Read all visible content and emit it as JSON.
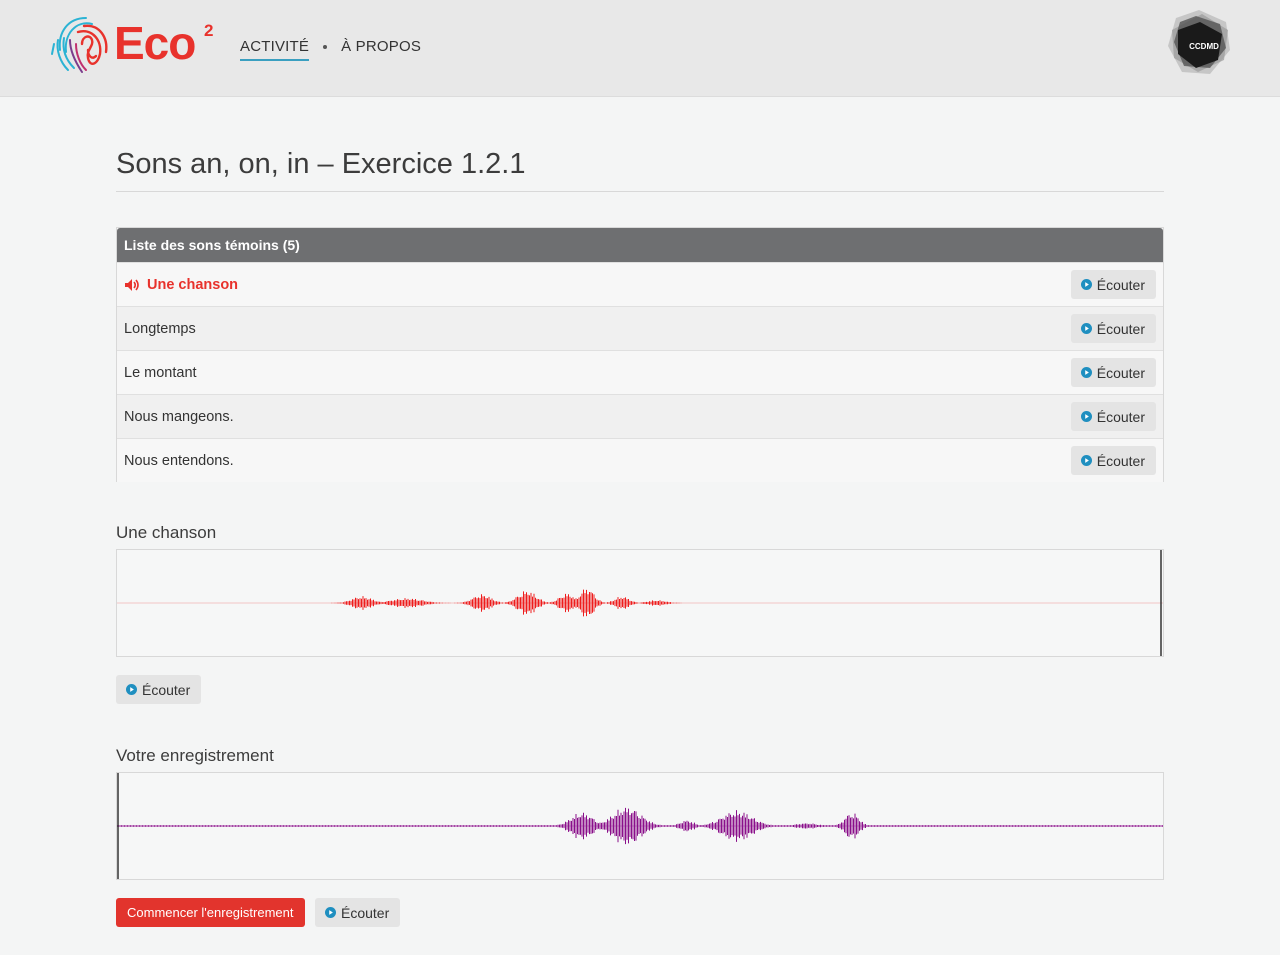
{
  "header": {
    "logo_text": "Eco",
    "logo_sup": "2",
    "nav": [
      {
        "label": "ACTIVITÉ",
        "active": true
      },
      {
        "label": "À PROPOS",
        "active": false
      }
    ],
    "badge_text": "CCDMD"
  },
  "page": {
    "title": "Sons an, on, in – Exercice 1.2.1"
  },
  "panel": {
    "heading": "Liste des sons témoins (5)",
    "items": [
      {
        "label": "Une chanson",
        "button": "Écouter",
        "active": true
      },
      {
        "label": "Longtemps",
        "button": "Écouter",
        "active": false
      },
      {
        "label": "Le montant",
        "button": "Écouter",
        "active": false
      },
      {
        "label": "Nous mangeons.",
        "button": "Écouter",
        "active": false
      },
      {
        "label": "Nous entendons.",
        "button": "Écouter",
        "active": false
      }
    ]
  },
  "reference": {
    "label": "Une chanson",
    "button": "Écouter"
  },
  "recording": {
    "label": "Votre enregistrement",
    "record_button": "Commencer l'enregistrement",
    "listen_button": "Écouter"
  },
  "colors": {
    "accent": "#e8322c",
    "nav_underline": "#3a9fc0",
    "panel_header": "#6e6f71",
    "reference_wave": "#ee1c1c",
    "recording_wave": "#8a0f8a",
    "play_icon": "#1f8fc0"
  }
}
